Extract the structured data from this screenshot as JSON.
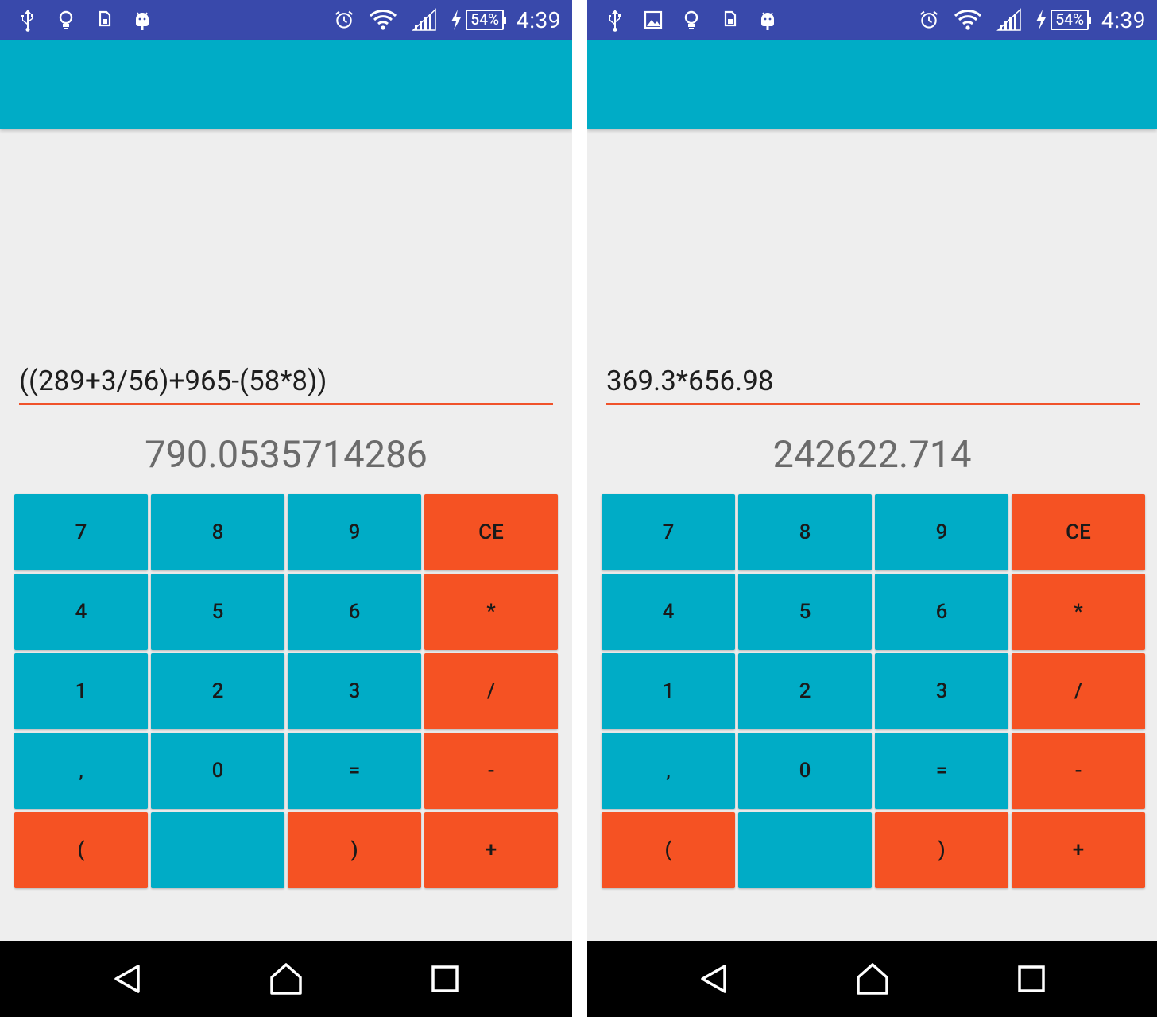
{
  "status_bar": {
    "time": "4:39",
    "battery_percent": "54%",
    "left_icons": [
      "usb-icon",
      "lightbulb-icon",
      "sim-storage-icon",
      "android-debug-icon"
    ],
    "right_icons": [
      "alarm-icon",
      "wifi-icon",
      "signal-icon",
      "charging-icon"
    ]
  },
  "screens": [
    {
      "expression": "((289+3/56)+965-(58*8))",
      "result": "790.0535714286"
    },
    {
      "expression": "369.3*656.98",
      "result": "242622.714"
    }
  ],
  "keypad": {
    "keys": [
      "7",
      "8",
      "9",
      "CE",
      "4",
      "5",
      "6",
      "*",
      "1",
      "2",
      "3",
      "/",
      ",",
      "0",
      "=",
      "-",
      "(",
      "",
      ")",
      "+"
    ],
    "colors": {
      "teal": "#00acc6",
      "orange": "#f55223"
    }
  },
  "navigation": {
    "buttons": [
      "back-icon",
      "home-icon",
      "recent-apps-icon"
    ]
  },
  "colors": {
    "status_bar": "#3949ab",
    "toolbar": "#00acc6",
    "background": "#eeeeee",
    "underline": "#f0522a"
  }
}
